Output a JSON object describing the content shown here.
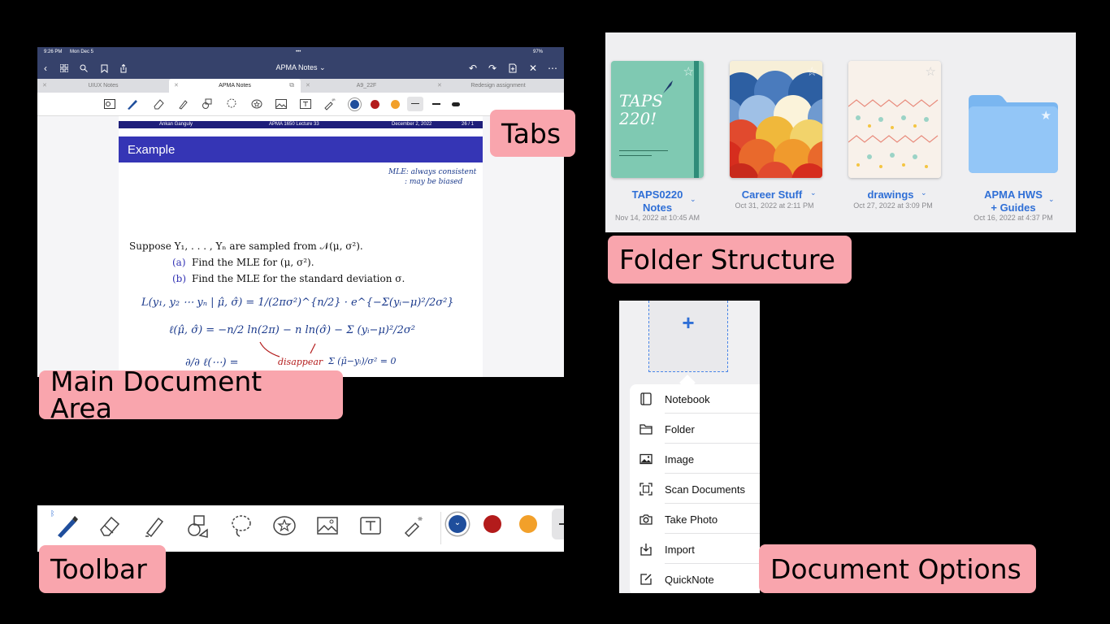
{
  "labels": {
    "tabs": "Tabs",
    "folder_structure": "Folder Structure",
    "main_document_area": "Main Document Area",
    "toolbar": "Toolbar",
    "document_options": "Document Options"
  },
  "app": {
    "status": {
      "time": "9:26 PM",
      "date": "Mon Dec 5",
      "dots": "•••",
      "battery": "97%"
    },
    "title": "APMA Notes ⌄",
    "tabs": [
      {
        "label": "UIUX Notes"
      },
      {
        "label": "APMA Notes"
      },
      {
        "label": "A9_22F"
      },
      {
        "label": "Redesign assignment"
      }
    ],
    "slide": {
      "author": "Ankan Ganguly",
      "course": "APMA 1650 Lecture 33",
      "date": "December 2, 2022",
      "page": "26 / 1",
      "title": "Example",
      "line1": "Suppose Y₁, . . . , Yₙ are sampled from 𝒩(μ, σ²).",
      "item_a_mark": "(a)",
      "item_a": "Find the MLE for (μ, σ²).",
      "item_b_mark": "(b)",
      "item_b": "Find the MLE for the standard deviation σ."
    },
    "handwriting": {
      "note1": "MLE: always consistent",
      "note2": ": may be biased",
      "eq1": "L(y₁, y₂ ⋯ yₙ | μ̂, σ̂) = 1/(2πσ²)^{n/2} · e^{−Σ(yᵢ−μ)²/2σ²}",
      "eq2": "ℓ(μ̂, σ̂) = −n/2 ln(2π) − n ln(σ̂) − Σ (yᵢ−μ)²/2σ²",
      "eq3": "∂/∂ ℓ(⋯) =",
      "eq3_red": "disappear",
      "eq3_tail": "Σ (μ̂−yᵢ)/σ² = 0"
    }
  },
  "folders": [
    {
      "name": "TAPS0220\nNotes",
      "line1": "TAPS0220",
      "line2": "Notes",
      "date": "Nov 14, 2022 at 10:45 AM",
      "cover_text": "TAPS 220!"
    },
    {
      "name": "Career Stuff",
      "line1": "Career Stuff",
      "line2": "",
      "date": "Oct 31, 2022 at 2:11 PM"
    },
    {
      "name": "drawings",
      "line1": "drawings",
      "line2": "",
      "date": "Oct 27, 2022 at 3:09 PM"
    },
    {
      "name": "APMA HWS + Guides",
      "line1": "APMA HWS",
      "line2": "+ Guides",
      "date": "Oct 16, 2022 at 4:37 PM"
    }
  ],
  "toolbar_colors": [
    "#1f4e9c",
    "#b31b1b",
    "#f2a02a"
  ],
  "document_options": {
    "new_symbol": "+",
    "items": [
      {
        "label": "Notebook",
        "icon": "notebook-icon"
      },
      {
        "label": "Folder",
        "icon": "folder-icon"
      },
      {
        "label": "Image",
        "icon": "image-icon"
      },
      {
        "label": "Scan Documents",
        "icon": "scan-icon"
      },
      {
        "label": "Take Photo",
        "icon": "camera-icon"
      },
      {
        "label": "Import",
        "icon": "import-icon"
      },
      {
        "label": "QuickNote",
        "icon": "quicknote-icon"
      }
    ]
  },
  "colors": {
    "nav": "#36426b",
    "accent_blue": "#2f6fd6",
    "label_pink": "#f9a5ad"
  }
}
